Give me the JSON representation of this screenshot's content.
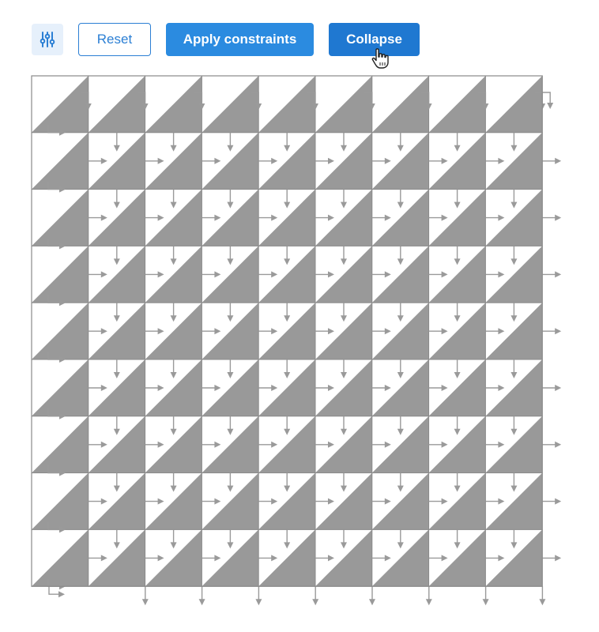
{
  "toolbar": {
    "settings_icon": "sliders-icon",
    "reset_label": "Reset",
    "apply_label": "Apply constraints",
    "collapse_label": "Collapse"
  },
  "grid": {
    "rows": 9,
    "cols": 9,
    "colors": {
      "fill": "#999999",
      "line": "#8a8a8a",
      "arrow": "#9a9a9a",
      "accent": "#2b8be0"
    }
  }
}
